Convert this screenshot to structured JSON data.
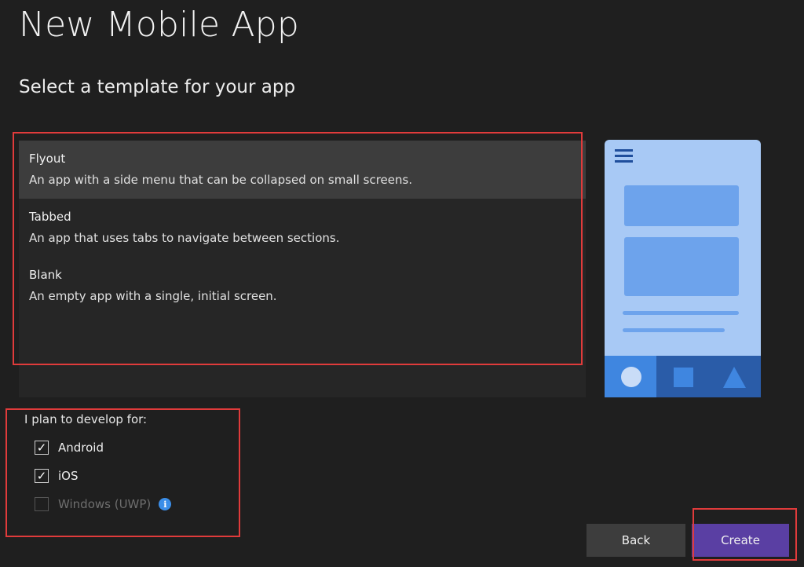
{
  "page": {
    "title": "New Mobile App",
    "subtitle": "Select a template for your app"
  },
  "templates": [
    {
      "name": "Flyout",
      "description": "An app with a side menu that can be collapsed on small screens.",
      "selected": true
    },
    {
      "name": "Tabbed",
      "description": "An app that uses tabs to navigate between sections.",
      "selected": false
    },
    {
      "name": "Blank",
      "description": "An empty app with a single, initial screen.",
      "selected": false
    }
  ],
  "platforms": {
    "label": "I plan to develop for:",
    "options": [
      {
        "label": "Android",
        "checked": true,
        "enabled": true
      },
      {
        "label": "iOS",
        "checked": true,
        "enabled": true
      },
      {
        "label": "Windows (UWP)",
        "checked": false,
        "enabled": false
      }
    ]
  },
  "buttons": {
    "back": "Back",
    "create": "Create"
  },
  "colors": {
    "highlight": "#e03b3b",
    "create_button": "#5a3fa3",
    "preview_background": "#a8c9f5",
    "preview_accent": "#3f86e0"
  },
  "icons": {
    "preview_menu": "hamburger-icon",
    "preview_tabs": [
      "circle-icon",
      "square-icon",
      "triangle-icon"
    ],
    "info": "info-icon"
  }
}
